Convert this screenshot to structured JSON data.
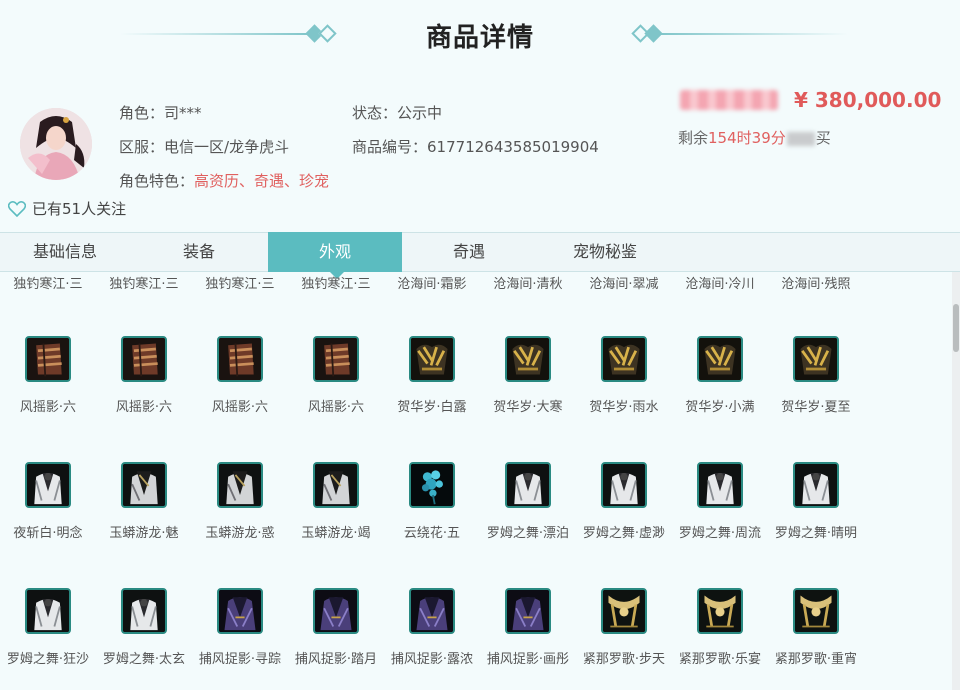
{
  "header": {
    "title": "商品详情"
  },
  "seller": {
    "role_label": "角色：",
    "role_value": "司***",
    "server_label": "区服：",
    "server_value": "电信一区/龙争虎斗",
    "traits_label": "角色特色：",
    "traits": "高资历、奇遇、珍宠",
    "status_label": "状态：",
    "status_value": "公示中",
    "id_label": "商品编号：",
    "id_value": "617712643585019904",
    "followers": "已有51人关注"
  },
  "price": {
    "amount": "¥ 380,000.00",
    "remain_prefix": "剩余",
    "remain_time": "154时39分",
    "remain_suffix": "买"
  },
  "tabs": [
    {
      "label": "基础信息",
      "active": false
    },
    {
      "label": "装备",
      "active": false
    },
    {
      "label": "外观",
      "active": true
    },
    {
      "label": "奇遇",
      "active": false
    },
    {
      "label": "宠物秘鉴",
      "active": false
    }
  ],
  "partial_row": [
    "独钓寒江·三",
    "独钓寒江·三",
    "独钓寒江·三",
    "独钓寒江·三",
    "沧海间·霜影",
    "沧海间·清秋",
    "沧海间·翠减",
    "沧海间·冷川",
    "沧海间·残照"
  ],
  "rows": [
    [
      {
        "name": "风摇影·六",
        "icon": "bracer-icon"
      },
      {
        "name": "风摇影·六",
        "icon": "bracer-icon"
      },
      {
        "name": "风摇影·六",
        "icon": "bracer-icon"
      },
      {
        "name": "风摇影·六",
        "icon": "bracer-icon"
      },
      {
        "name": "贺华岁·白露",
        "icon": "gold-armor-icon"
      },
      {
        "name": "贺华岁·大寒",
        "icon": "gold-armor-icon"
      },
      {
        "name": "贺华岁·雨水",
        "icon": "gold-armor-icon"
      },
      {
        "name": "贺华岁·小满",
        "icon": "gold-armor-icon"
      },
      {
        "name": "贺华岁·夏至",
        "icon": "gold-armor-icon"
      }
    ],
    [
      {
        "name": "夜斩白·明念",
        "icon": "white-robe-icon"
      },
      {
        "name": "玉蟒游龙·魅",
        "icon": "dark-robe-icon"
      },
      {
        "name": "玉蟒游龙·惑",
        "icon": "dark-robe-icon"
      },
      {
        "name": "玉蟒游龙·竭",
        "icon": "dark-robe-icon"
      },
      {
        "name": "云绕花·五",
        "icon": "blue-flower-icon"
      },
      {
        "name": "罗姆之舞·漂泊",
        "icon": "white-robe-icon"
      },
      {
        "name": "罗姆之舞·虚渺",
        "icon": "white-robe-icon"
      },
      {
        "name": "罗姆之舞·周流",
        "icon": "white-robe-icon"
      },
      {
        "name": "罗姆之舞·晴明",
        "icon": "white-robe-icon"
      }
    ],
    [
      {
        "name": "罗姆之舞·狂沙",
        "icon": "white-robe-icon"
      },
      {
        "name": "罗姆之舞·太玄",
        "icon": "white-robe-icon"
      },
      {
        "name": "捕风捉影·寻踪",
        "icon": "purple-robe-icon"
      },
      {
        "name": "捕风捉影·踏月",
        "icon": "purple-robe-icon"
      },
      {
        "name": "捕风捉影·露浓",
        "icon": "purple-robe-icon"
      },
      {
        "name": "捕风捉影·画彤",
        "icon": "purple-robe-icon"
      },
      {
        "name": "紧那罗歌·步天",
        "icon": "gold-collar-icon"
      },
      {
        "name": "紧那罗歌·乐宴",
        "icon": "gold-collar-icon"
      },
      {
        "name": "紧那罗歌·重宵",
        "icon": "gold-collar-icon"
      }
    ]
  ]
}
